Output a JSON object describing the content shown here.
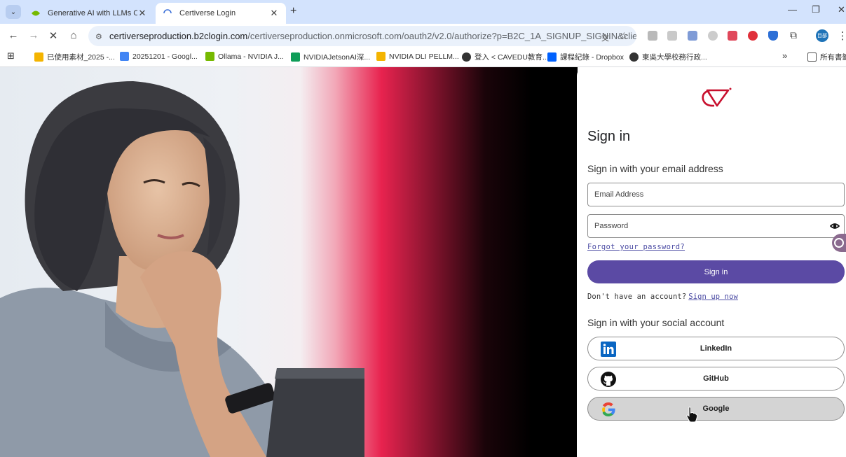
{
  "browser": {
    "tabs": [
      {
        "title": "Generative AI with LLMs Certi"
      },
      {
        "title": "Certiverse Login"
      }
    ],
    "url_host": "certiverseproduction.b2clogin.com",
    "url_path": "/certiverseproduction.onmicrosoft.com/oauth2/v2.0/authorize?p=B2C_1A_SIGNUP_SIGNIN&clie...",
    "profile_label": "目部",
    "bookmarks": [
      "已使用素材_2025 -...",
      "20251201 - Googl...",
      "Ollama - NVIDIA J...",
      "NVIDIAJetsonAI深...",
      "NVIDIA DLI PELLM...",
      "登入 < CAVEDU教育...",
      "課程紀錄 - Dropbox",
      "東吳大學校務行政...",
      "所有書籤"
    ],
    "more_bookmarks": "»",
    "colors": {
      "chrome": "#d3e3fd",
      "omnibox": "#eaf1fb"
    }
  },
  "signin": {
    "title": "Sign in",
    "email_heading": "Sign in with your email address",
    "email_placeholder": "Email Address",
    "password_placeholder": "Password",
    "forgot_link": "Forgot your password?",
    "submit_label": "Sign in",
    "no_account_text": "Don't have an account?",
    "signup_link": "Sign up now",
    "social_heading": "Sign in with your social account",
    "social": [
      {
        "label": "LinkedIn"
      },
      {
        "label": "GitHub"
      },
      {
        "label": "Google"
      }
    ],
    "colors": {
      "primary": "#5b4aa4",
      "logo": "#c8102e",
      "link": "#4b4ba3"
    }
  }
}
